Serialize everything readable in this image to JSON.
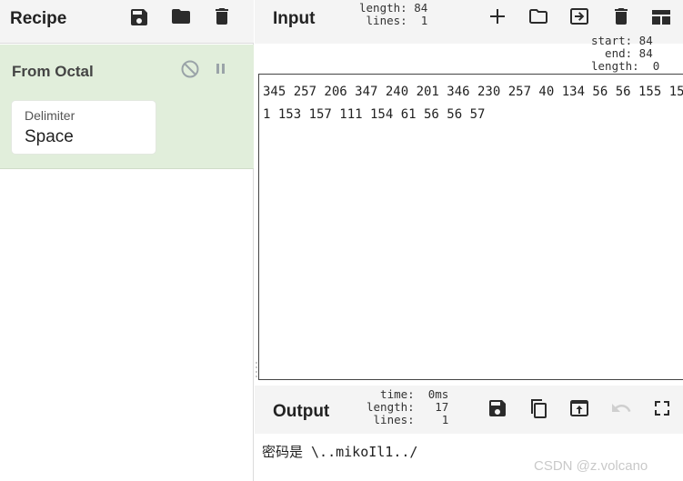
{
  "recipe": {
    "title": "Recipe",
    "icons": [
      "save-icon",
      "folder-icon",
      "trash-icon"
    ],
    "operation": {
      "name": "From Octal",
      "disable_icon": "disable-icon",
      "pause_icon": "pause-icon",
      "field_label": "Delimiter",
      "field_value": "Space"
    }
  },
  "input": {
    "title": "Input",
    "stats": "length: 84\n lines:  1",
    "selection": "start: 84\n  end: 84\nlength:  0",
    "icons": [
      "plus-icon",
      "folder-icon",
      "import-icon",
      "trash-icon",
      "layout-icon"
    ],
    "text": "345 257 206 347 240 201 346 230 257 40 134 56 56 155 151 153 157 111 154 61 56 56 57"
  },
  "output": {
    "title": "Output",
    "stats": "  time:  0ms\nlength:   17\n lines:    1",
    "icons": [
      "save-icon",
      "copy-icon",
      "replace-input-icon",
      "undo-icon",
      "fullscreen-icon"
    ],
    "text": "密码是 \\..mikoIl1../",
    "watermark": "CSDN @z.volcano"
  },
  "colors": {
    "operation_bg": "#e1eedb",
    "header_bg": "#f4f4f4",
    "icon": "#2b2b2b",
    "icon_muted": "#9aa3a8"
  }
}
